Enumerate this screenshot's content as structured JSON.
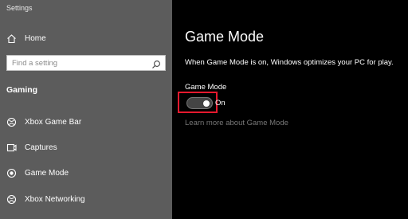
{
  "window": {
    "title": "Settings"
  },
  "sidebar": {
    "home_label": "Home",
    "search": {
      "placeholder": "Find a setting",
      "value": ""
    },
    "section_header": "Gaming",
    "items": [
      {
        "label": "Xbox Game Bar",
        "icon": "xbox-icon"
      },
      {
        "label": "Captures",
        "icon": "captures-icon"
      },
      {
        "label": "Game Mode",
        "icon": "game-mode-icon"
      },
      {
        "label": "Xbox Networking",
        "icon": "xbox-icon"
      }
    ]
  },
  "main": {
    "title": "Game Mode",
    "description": "When Game Mode is on, Windows optimizes your PC for play.",
    "toggle": {
      "label": "Game Mode",
      "state_label": "On",
      "is_on": true
    },
    "learn_more": "Learn more about Game Mode"
  },
  "colors": {
    "sidebar_bg": "#5c5c5c",
    "content_bg": "#000000",
    "highlight": "#e5192e",
    "link": "#777777"
  }
}
